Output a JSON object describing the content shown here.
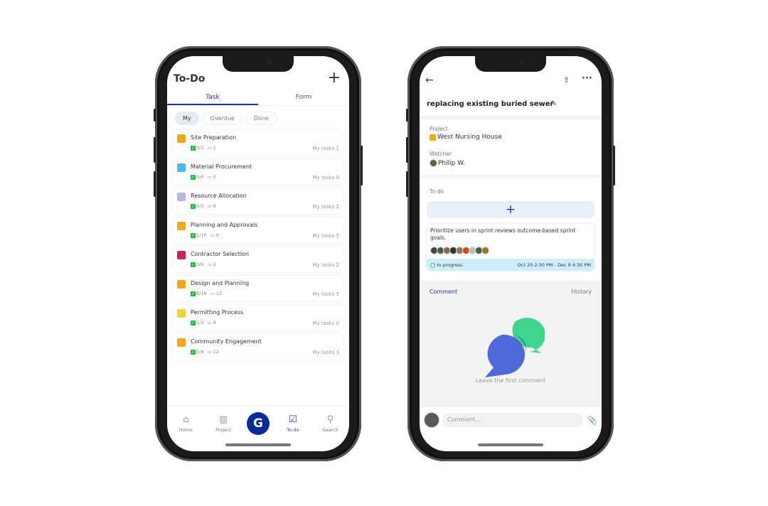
{
  "left": {
    "title": "To-Do",
    "add_icon": "plus-icon",
    "tabs": [
      {
        "label": "Task",
        "active": true
      },
      {
        "label": "Form",
        "active": false
      }
    ],
    "filters": [
      {
        "label": "My",
        "active": true
      },
      {
        "label": "Overdue",
        "active": false
      },
      {
        "label": "Done",
        "active": false
      }
    ],
    "tasks": [
      {
        "name": "Site Preparation",
        "checks": "0/2",
        "comments": "1",
        "my_tasks": "My tasks 1",
        "icon_color": "#f0a81c"
      },
      {
        "name": "Material Procurement",
        "checks": "0/0",
        "comments": "0",
        "my_tasks": "My tasks 0",
        "icon_color": "#4bbde8"
      },
      {
        "name": "Resource Allocation",
        "checks": "4/5",
        "comments": "9",
        "my_tasks": "My tasks 2",
        "icon_color": "#b9b6e6"
      },
      {
        "name": "Planning and Approvals",
        "checks": "1/10",
        "comments": "0",
        "my_tasks": "My tasks 5",
        "icon_color": "#f0a81c"
      },
      {
        "name": "Contractor Selection",
        "checks": "3/6",
        "comments": "2",
        "my_tasks": "My tasks 2",
        "icon_color": "#c8264c"
      },
      {
        "name": "Design and Planning",
        "checks": "8/16",
        "comments": "12",
        "my_tasks": "My tasks 5",
        "icon_color": "#f0a81c"
      },
      {
        "name": "Permitting Process",
        "checks": "1/2",
        "comments": "8",
        "my_tasks": "My tasks 0",
        "icon_color": "#f5d23a"
      },
      {
        "name": "Community Engagement",
        "checks": "5/8",
        "comments": "12",
        "my_tasks": "My tasks 3",
        "icon_color": "#f0a81c"
      }
    ],
    "nav": [
      {
        "label": "Home",
        "icon": "home-icon",
        "active": false
      },
      {
        "label": "Project",
        "icon": "project-icon",
        "active": false
      },
      {
        "label": "To-do",
        "icon": "clipboard-check-icon",
        "active": true
      },
      {
        "label": "Search",
        "icon": "search-icon",
        "active": false
      }
    ],
    "center_button": "G"
  },
  "right": {
    "title": "replacing existing buried sewer",
    "project_label": "Project",
    "project_value": "West Nursing House",
    "watcher_label": "Watcher",
    "watcher_value": "Philip W.",
    "todo_label": "To-do",
    "add_label": "+",
    "task": {
      "title": "Prioritize users in sprint reviews outcome-based sprint goals.",
      "status": "In progress",
      "dates": "Oct 20 2:30 PM - Dec 9 4:30 PM",
      "assignees": 9
    },
    "tabs": [
      {
        "label": "Comment",
        "active": true
      },
      {
        "label": "History",
        "active": false
      }
    ],
    "empty_text": "Leave the first comment",
    "comment_placeholder": "Comment...",
    "accent": "#1a3ba8"
  }
}
